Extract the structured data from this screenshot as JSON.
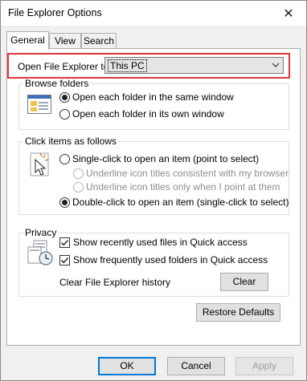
{
  "window": {
    "title": "File Explorer Options",
    "close_glyph": "✕"
  },
  "tabs": [
    {
      "label": "General",
      "active": true
    },
    {
      "label": "View",
      "active": false
    },
    {
      "label": "Search",
      "active": false
    }
  ],
  "open_explorer": {
    "label": "Open File Explorer to:",
    "value": "This PC",
    "highlight_color": "#e0363c"
  },
  "browse_folders": {
    "title": "Browse folders",
    "icon": "browse-folders-icon",
    "options": [
      {
        "label": "Open each folder in the same window",
        "checked": true
      },
      {
        "label": "Open each folder in its own window",
        "checked": false
      }
    ]
  },
  "click_items": {
    "title": "Click items as follows",
    "icon": "pointer-click-icon",
    "single_click": {
      "label": "Single-click to open an item (point to select)",
      "checked": false
    },
    "sub_options": [
      {
        "label": "Underline icon titles consistent with my browser",
        "checked": false,
        "disabled": true
      },
      {
        "label": "Underline icon titles only when I point at them",
        "checked": false,
        "disabled": true
      }
    ],
    "double_click": {
      "label": "Double-click to open an item (single-click to select)",
      "checked": true
    }
  },
  "privacy": {
    "title": "Privacy",
    "icon": "privacy-icon",
    "checks": [
      {
        "label": "Show recently used files in Quick access",
        "checked": true
      },
      {
        "label": "Show frequently used folders in Quick access",
        "checked": true
      }
    ],
    "clear_label": "Clear File Explorer history",
    "clear_button": "Clear"
  },
  "restore_defaults": "Restore Defaults",
  "footer": {
    "ok": "OK",
    "cancel": "Cancel",
    "apply": "Apply"
  }
}
